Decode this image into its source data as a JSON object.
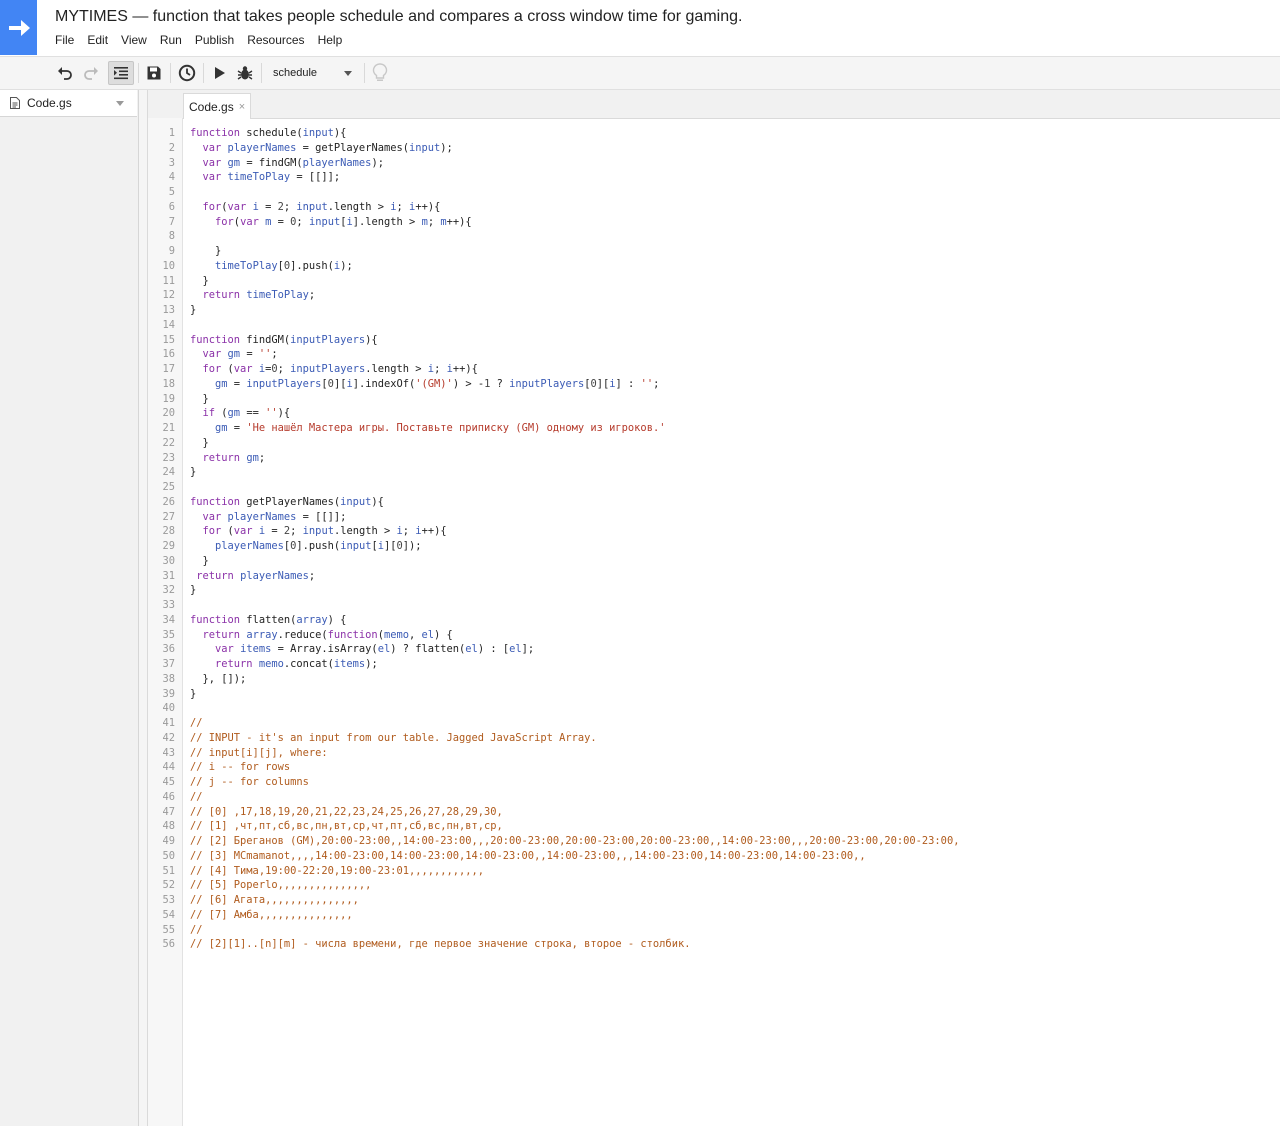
{
  "app": {
    "title": "MYTIMES — function that takes people schedule and compares a cross window time for gaming."
  },
  "menu": [
    "File",
    "Edit",
    "View",
    "Run",
    "Publish",
    "Resources",
    "Help"
  ],
  "toolbar": {
    "icons": [
      "undo-icon",
      "redo-icon",
      "indent-icon",
      "save-icon",
      "clock-icon",
      "play-icon",
      "debug-bug-icon",
      "lightbulb-icon"
    ],
    "function_select": "schedule"
  },
  "files": [
    {
      "name": "Code.gs"
    }
  ],
  "editor": {
    "tab_label": "Code.gs",
    "tab_close": "×",
    "lines": [
      [
        [
          "kw",
          "function"
        ],
        [
          "fn",
          " schedule("
        ],
        [
          "vr",
          "input"
        ],
        [
          "fn",
          "){"
        ]
      ],
      [
        [
          "kw",
          "  var"
        ],
        [
          "fn",
          " "
        ],
        [
          "vr",
          "playerNames"
        ],
        [
          "fn",
          " = getPlayerNames("
        ],
        [
          "vr",
          "input"
        ],
        [
          "fn",
          ");"
        ]
      ],
      [
        [
          "kw",
          "  var"
        ],
        [
          "fn",
          " "
        ],
        [
          "vr",
          "gm"
        ],
        [
          "fn",
          " = findGM("
        ],
        [
          "vr",
          "playerNames"
        ],
        [
          "fn",
          ");"
        ]
      ],
      [
        [
          "kw",
          "  var"
        ],
        [
          "fn",
          " "
        ],
        [
          "vr",
          "timeToPlay"
        ],
        [
          "fn",
          " = [[]];"
        ]
      ],
      [],
      [
        [
          "kw",
          "  for"
        ],
        [
          "fn",
          "("
        ],
        [
          "kw",
          "var"
        ],
        [
          "fn",
          " "
        ],
        [
          "vr",
          "i"
        ],
        [
          "fn",
          " = "
        ],
        [
          "nm",
          "2"
        ],
        [
          "fn",
          "; "
        ],
        [
          "vr",
          "input"
        ],
        [
          "fn",
          ".length > "
        ],
        [
          "vr",
          "i"
        ],
        [
          "fn",
          "; "
        ],
        [
          "vr",
          "i"
        ],
        [
          "fn",
          "++){"
        ]
      ],
      [
        [
          "kw",
          "    for"
        ],
        [
          "fn",
          "("
        ],
        [
          "kw",
          "var"
        ],
        [
          "fn",
          " "
        ],
        [
          "vr",
          "m"
        ],
        [
          "fn",
          " = "
        ],
        [
          "nm",
          "0"
        ],
        [
          "fn",
          "; "
        ],
        [
          "vr",
          "input"
        ],
        [
          "fn",
          "["
        ],
        [
          "vr",
          "i"
        ],
        [
          "fn",
          "].length > "
        ],
        [
          "vr",
          "m"
        ],
        [
          "fn",
          "; "
        ],
        [
          "vr",
          "m"
        ],
        [
          "fn",
          "++){"
        ]
      ],
      [],
      [
        [
          "fn",
          "    }"
        ]
      ],
      [
        [
          "fn",
          "    "
        ],
        [
          "vr",
          "timeToPlay"
        ],
        [
          "fn",
          "["
        ],
        [
          "nm",
          "0"
        ],
        [
          "fn",
          "].push("
        ],
        [
          "vr",
          "i"
        ],
        [
          "fn",
          ");"
        ]
      ],
      [
        [
          "fn",
          "  }"
        ]
      ],
      [
        [
          "kw",
          "  return"
        ],
        [
          "fn",
          " "
        ],
        [
          "vr",
          "timeToPlay"
        ],
        [
          "fn",
          ";"
        ]
      ],
      [
        [
          "fn",
          "}"
        ]
      ],
      [],
      [
        [
          "kw",
          "function"
        ],
        [
          "fn",
          " findGM("
        ],
        [
          "vr",
          "inputPlayers"
        ],
        [
          "fn",
          "){"
        ]
      ],
      [
        [
          "kw",
          "  var"
        ],
        [
          "fn",
          " "
        ],
        [
          "vr",
          "gm"
        ],
        [
          "fn",
          " = "
        ],
        [
          "st",
          "''"
        ],
        [
          "fn",
          ";"
        ]
      ],
      [
        [
          "kw",
          "  for"
        ],
        [
          "fn",
          " ("
        ],
        [
          "kw",
          "var"
        ],
        [
          "fn",
          " "
        ],
        [
          "vr",
          "i"
        ],
        [
          "fn",
          "="
        ],
        [
          "nm",
          "0"
        ],
        [
          "fn",
          "; "
        ],
        [
          "vr",
          "inputPlayers"
        ],
        [
          "fn",
          ".length > "
        ],
        [
          "vr",
          "i"
        ],
        [
          "fn",
          "; "
        ],
        [
          "vr",
          "i"
        ],
        [
          "fn",
          "++){"
        ]
      ],
      [
        [
          "fn",
          "    "
        ],
        [
          "vr",
          "gm"
        ],
        [
          "fn",
          " = "
        ],
        [
          "vr",
          "inputPlayers"
        ],
        [
          "fn",
          "["
        ],
        [
          "nm",
          "0"
        ],
        [
          "fn",
          "]["
        ],
        [
          "vr",
          "i"
        ],
        [
          "fn",
          "].indexOf("
        ],
        [
          "st",
          "'(GM)'"
        ],
        [
          "fn",
          ") > -"
        ],
        [
          "nm",
          "1"
        ],
        [
          "fn",
          " ? "
        ],
        [
          "vr",
          "inputPlayers"
        ],
        [
          "fn",
          "["
        ],
        [
          "nm",
          "0"
        ],
        [
          "fn",
          "]["
        ],
        [
          "vr",
          "i"
        ],
        [
          "fn",
          "] : "
        ],
        [
          "st",
          "''"
        ],
        [
          "fn",
          ";"
        ]
      ],
      [
        [
          "fn",
          "  }"
        ]
      ],
      [
        [
          "kw",
          "  if"
        ],
        [
          "fn",
          " ("
        ],
        [
          "vr",
          "gm"
        ],
        [
          "fn",
          " == "
        ],
        [
          "st",
          "''"
        ],
        [
          "fn",
          "){"
        ]
      ],
      [
        [
          "fn",
          "    "
        ],
        [
          "vr",
          "gm"
        ],
        [
          "fn",
          " = "
        ],
        [
          "st",
          "'Не нашёл Мастера игры. Поставьте приписку (GM) одному из игроков.'"
        ]
      ],
      [
        [
          "fn",
          "  }"
        ]
      ],
      [
        [
          "kw",
          "  return"
        ],
        [
          "fn",
          " "
        ],
        [
          "vr",
          "gm"
        ],
        [
          "fn",
          ";"
        ]
      ],
      [
        [
          "fn",
          "}"
        ]
      ],
      [],
      [
        [
          "kw",
          "function"
        ],
        [
          "fn",
          " getPlayerNames("
        ],
        [
          "vr",
          "input"
        ],
        [
          "fn",
          "){"
        ]
      ],
      [
        [
          "kw",
          "  var"
        ],
        [
          "fn",
          " "
        ],
        [
          "vr",
          "playerNames"
        ],
        [
          "fn",
          " = [[]];"
        ]
      ],
      [
        [
          "kw",
          "  for"
        ],
        [
          "fn",
          " ("
        ],
        [
          "kw",
          "var"
        ],
        [
          "fn",
          " "
        ],
        [
          "vr",
          "i"
        ],
        [
          "fn",
          " = "
        ],
        [
          "nm",
          "2"
        ],
        [
          "fn",
          "; "
        ],
        [
          "vr",
          "input"
        ],
        [
          "fn",
          ".length > "
        ],
        [
          "vr",
          "i"
        ],
        [
          "fn",
          "; "
        ],
        [
          "vr",
          "i"
        ],
        [
          "fn",
          "++){"
        ]
      ],
      [
        [
          "fn",
          "    "
        ],
        [
          "vr",
          "playerNames"
        ],
        [
          "fn",
          "["
        ],
        [
          "nm",
          "0"
        ],
        [
          "fn",
          "].push("
        ],
        [
          "vr",
          "input"
        ],
        [
          "fn",
          "["
        ],
        [
          "vr",
          "i"
        ],
        [
          "fn",
          "]["
        ],
        [
          "nm",
          "0"
        ],
        [
          "fn",
          "]);"
        ]
      ],
      [
        [
          "fn",
          "  }"
        ]
      ],
      [
        [
          "kw",
          " return"
        ],
        [
          "fn",
          " "
        ],
        [
          "vr",
          "playerNames"
        ],
        [
          "fn",
          ";"
        ]
      ],
      [
        [
          "fn",
          "}"
        ]
      ],
      [],
      [
        [
          "kw",
          "function"
        ],
        [
          "fn",
          " flatten("
        ],
        [
          "vr",
          "array"
        ],
        [
          "fn",
          ") {"
        ]
      ],
      [
        [
          "kw",
          "  return"
        ],
        [
          "fn",
          " "
        ],
        [
          "vr",
          "array"
        ],
        [
          "fn",
          ".reduce("
        ],
        [
          "kw",
          "function"
        ],
        [
          "fn",
          "("
        ],
        [
          "vr",
          "memo"
        ],
        [
          "fn",
          ", "
        ],
        [
          "vr",
          "el"
        ],
        [
          "fn",
          ") {"
        ]
      ],
      [
        [
          "kw",
          "    var"
        ],
        [
          "fn",
          " "
        ],
        [
          "vr",
          "items"
        ],
        [
          "fn",
          " = Array.isArray("
        ],
        [
          "vr",
          "el"
        ],
        [
          "fn",
          ") ? flatten("
        ],
        [
          "vr",
          "el"
        ],
        [
          "fn",
          ") : ["
        ],
        [
          "vr",
          "el"
        ],
        [
          "fn",
          "];"
        ]
      ],
      [
        [
          "kw",
          "    return"
        ],
        [
          "fn",
          " "
        ],
        [
          "vr",
          "memo"
        ],
        [
          "fn",
          ".concat("
        ],
        [
          "vr",
          "items"
        ],
        [
          "fn",
          ");"
        ]
      ],
      [
        [
          "fn",
          "  }, []);"
        ]
      ],
      [
        [
          "fn",
          "}"
        ]
      ],
      [],
      [
        [
          "cm",
          "//"
        ]
      ],
      [
        [
          "cm",
          "// INPUT - it's an input from our table. Jagged JavaScript Array."
        ]
      ],
      [
        [
          "cm",
          "// input[i][j], where:"
        ]
      ],
      [
        [
          "cm",
          "// i -- for rows"
        ]
      ],
      [
        [
          "cm",
          "// j -- for columns"
        ]
      ],
      [
        [
          "cm",
          "//"
        ]
      ],
      [
        [
          "cm",
          "// [0] ,17,18,19,20,21,22,23,24,25,26,27,28,29,30,"
        ]
      ],
      [
        [
          "cm",
          "// [1] ,чт,пт,сб,вс,пн,вт,ср,чт,пт,сб,вс,пн,вт,ср,"
        ]
      ],
      [
        [
          "cm",
          "// [2] Бреганов (GM),20:00-23:00,,14:00-23:00,,,20:00-23:00,20:00-23:00,20:00-23:00,,14:00-23:00,,,20:00-23:00,20:00-23:00,"
        ]
      ],
      [
        [
          "cm",
          "// [3] MCmamanot,,,,14:00-23:00,14:00-23:00,14:00-23:00,,14:00-23:00,,,14:00-23:00,14:00-23:00,14:00-23:00,,"
        ]
      ],
      [
        [
          "cm",
          "// [4] Тима,19:00-22:20,19:00-23:01,,,,,,,,,,,,"
        ]
      ],
      [
        [
          "cm",
          "// [5] Poperlo,,,,,,,,,,,,,,,"
        ]
      ],
      [
        [
          "cm",
          "// [6] Агата,,,,,,,,,,,,,,,"
        ]
      ],
      [
        [
          "cm",
          "// [7] Амба,,,,,,,,,,,,,,,"
        ]
      ],
      [
        [
          "cm",
          "//"
        ]
      ],
      [
        [
          "cm",
          "// [2][1]..[n][m] - числа времени, где первое значение строка, второе - столбик."
        ]
      ]
    ]
  }
}
